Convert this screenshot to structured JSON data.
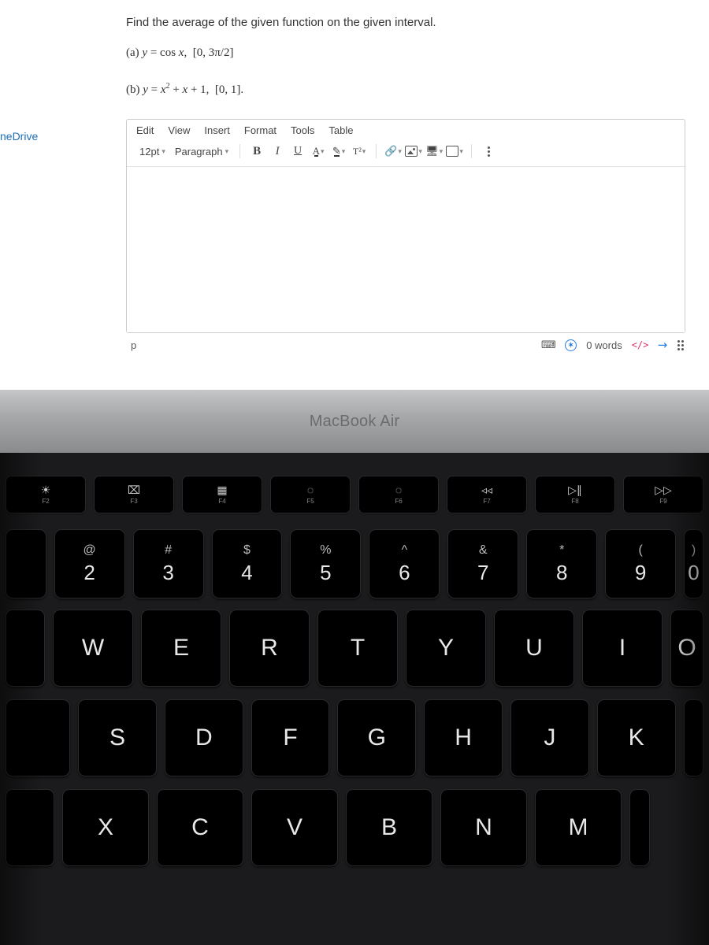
{
  "sidebar": {
    "link": "neDrive"
  },
  "question": {
    "prompt": "Find the average of the given function on the given interval.",
    "part_a_html": "(a) <i>y</i> = cos <i>x</i>, &nbsp;[0, 3π/2]",
    "part_b_html": "(b) <i>y</i> = <i>x</i><sup>2</sup> + <i>x</i> + 1, &nbsp;[0, 1]."
  },
  "editor": {
    "menus": [
      "Edit",
      "View",
      "Insert",
      "Format",
      "Tools",
      "Table"
    ],
    "font_size": "12pt",
    "block_format": "Paragraph",
    "bold": "B",
    "italic": "I",
    "underline": "U",
    "textcolor": "A",
    "super": "T²",
    "path": "p",
    "word_count": "0 words",
    "code_toggle": "</>"
  },
  "laptop": {
    "brand": "MacBook Air",
    "fn": [
      {
        "sym": "☀",
        "lbl": "F2"
      },
      {
        "sym": "⌧",
        "lbl": "F3"
      },
      {
        "sym": "▦",
        "lbl": "F4"
      },
      {
        "sym": "◌",
        "lbl": "F5"
      },
      {
        "sym": "◌",
        "lbl": "F6"
      },
      {
        "sym": "◃◃",
        "lbl": "F7"
      },
      {
        "sym": "▷∥",
        "lbl": "F8"
      },
      {
        "sym": "▷▷",
        "lbl": "F9"
      }
    ],
    "num": [
      {
        "t": "@",
        "b": "2"
      },
      {
        "t": "#",
        "b": "3"
      },
      {
        "t": "$",
        "b": "4"
      },
      {
        "t": "%",
        "b": "5"
      },
      {
        "t": "^",
        "b": "6"
      },
      {
        "t": "&",
        "b": "7"
      },
      {
        "t": "*",
        "b": "8"
      },
      {
        "t": "(",
        "b": "9"
      },
      {
        "t": ")",
        "b": "0"
      }
    ],
    "row1": [
      "W",
      "E",
      "R",
      "T",
      "Y",
      "U",
      "I",
      "O"
    ],
    "row2": [
      "S",
      "D",
      "F",
      "G",
      "H",
      "J",
      "K"
    ],
    "row3": [
      "X",
      "C",
      "V",
      "B",
      "N",
      "M"
    ]
  }
}
